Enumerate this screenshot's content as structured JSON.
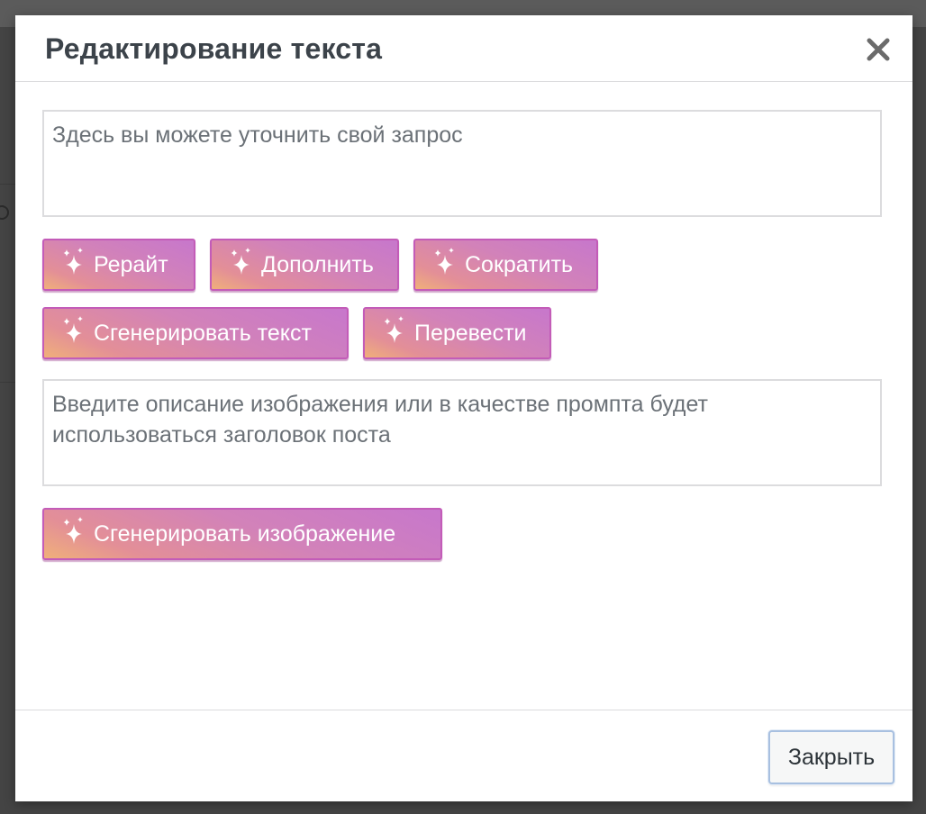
{
  "modal": {
    "title": "Редактирование текста",
    "close_icon": "close-icon"
  },
  "text_prompt": {
    "value": "",
    "placeholder": "Здесь вы можете уточнить свой запрос"
  },
  "text_actions": [
    {
      "label": "Рерайт",
      "icon": "sparkle-icon"
    },
    {
      "label": "Дополнить",
      "icon": "sparkle-icon"
    },
    {
      "label": "Сократить",
      "icon": "sparkle-icon"
    },
    {
      "label": "Сгенерировать текст",
      "icon": "sparkle-icon"
    },
    {
      "label": "Перевести",
      "icon": "sparkle-icon"
    }
  ],
  "image_prompt": {
    "value": "",
    "placeholder": "Введите описание изображения или в качестве промпта будет использоваться заголовок поста"
  },
  "image_action": {
    "label": "Сгенерировать изображение",
    "icon": "sparkle-icon"
  },
  "footer": {
    "close_label": "Закрыть"
  },
  "colors": {
    "ai_gradient_start": "#f0b07a",
    "ai_gradient_end": "#c777cc",
    "ai_border": "#c35cb8",
    "title_text": "#3c434a",
    "overlay": "#444444"
  }
}
